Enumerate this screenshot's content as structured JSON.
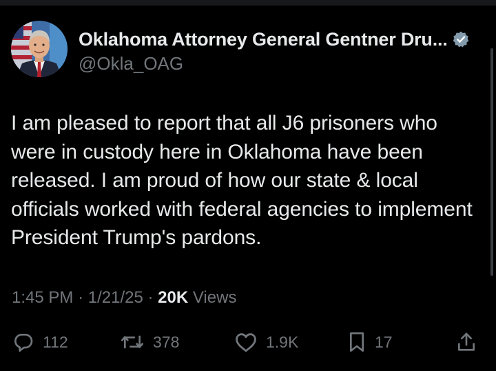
{
  "author": {
    "display_name": "Oklahoma Attorney General Gentner Dru...",
    "handle": "@Okla_OAG",
    "verified_icon": "verified-badge-icon",
    "avatar_icon": "profile-photo-avatar"
  },
  "tweet": {
    "text": "I am pleased to report that all J6 prisoners who were in custody here in Oklahoma have been released. I am proud of how our state & local officials worked with federal agencies to implement President Trump's pardons.",
    "time": "1:45 PM",
    "date": "1/21/25",
    "separator": "·",
    "views_count": "20K",
    "views_label": "Views"
  },
  "actions": {
    "replies": "112",
    "reposts": "378",
    "likes": "1.9K",
    "bookmarks": "17"
  },
  "colors": {
    "background": "#000000",
    "text_primary": "#e7e9ea",
    "text_secondary": "#71767b",
    "verified_badge": "#829aab"
  }
}
